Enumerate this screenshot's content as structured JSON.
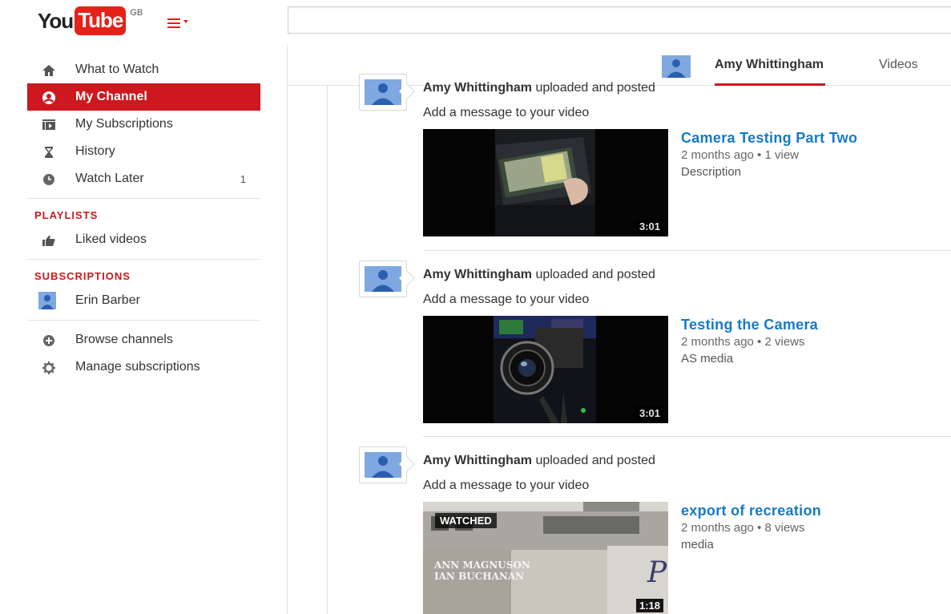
{
  "masthead": {
    "logo_you": "You",
    "logo_tube": "Tube",
    "region": "GB",
    "brand_color": "#e62117"
  },
  "sidebar": {
    "items": [
      {
        "label": "What to Watch",
        "icon": "home-icon"
      },
      {
        "label": "My Channel",
        "icon": "account-icon",
        "active": true
      },
      {
        "label": "My Subscriptions",
        "icon": "subscriptions-icon"
      },
      {
        "label": "History",
        "icon": "hourglass-icon"
      },
      {
        "label": "Watch Later",
        "icon": "clock-icon",
        "count": "1"
      }
    ],
    "playlists_title": "PLAYLISTS",
    "playlists": [
      {
        "label": "Liked videos",
        "icon": "thumbs-up-icon"
      }
    ],
    "subscriptions_title": "SUBSCRIPTIONS",
    "subscriptions": [
      {
        "label": "Erin Barber",
        "icon": "user-avatar-icon"
      }
    ],
    "footer_items": [
      {
        "label": "Browse channels",
        "icon": "plus-circle-icon"
      },
      {
        "label": "Manage subscriptions",
        "icon": "gear-icon"
      }
    ],
    "active_color": "#cc181e"
  },
  "channel_header": {
    "name": "Amy Whittingham",
    "tab_videos": "Videos"
  },
  "feed": [
    {
      "author": "Amy Whittingham",
      "action": " uploaded and posted",
      "message": "Add a message to your video",
      "title": "Camera Testing Part Two",
      "meta": "2 months ago • 1 view",
      "description": "Description",
      "duration": "3:01"
    },
    {
      "author": "Amy Whittingham",
      "action": " uploaded and posted",
      "message": "Add a message to your video",
      "title": "Testing the Camera",
      "meta": "2 months ago • 2 views",
      "description": "AS media",
      "duration": "3:01"
    },
    {
      "author": "Amy Whittingham",
      "action": " uploaded and posted",
      "message": "Add a message to your video",
      "title": "export of recreation",
      "meta": "2 months ago • 8 views",
      "description": "media",
      "duration": "1:18",
      "watched_label": "WATCHED",
      "thumb_text_1": "ANN MAGNUSON",
      "thumb_text_2": "IAN BUCHANAN"
    }
  ],
  "link_color": "#167ac6"
}
